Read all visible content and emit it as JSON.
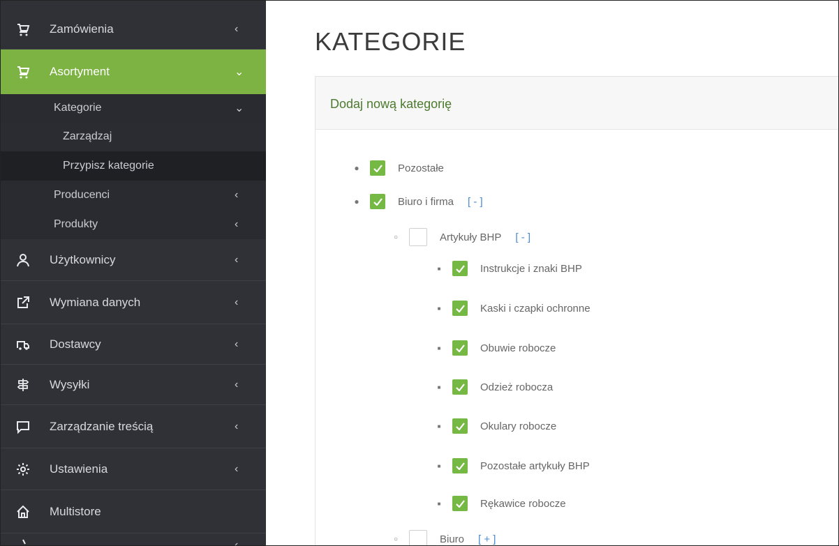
{
  "sidebar": {
    "items": [
      {
        "label": "Zamówienia",
        "icon": "cart-icon",
        "chevron": "‹"
      },
      {
        "label": "Asortyment",
        "icon": "cart-icon",
        "chevron": "⌄"
      },
      {
        "label": "Użytkownicy",
        "icon": "user-icon",
        "chevron": "‹"
      },
      {
        "label": "Wymiana danych",
        "icon": "external-link-icon",
        "chevron": "‹"
      },
      {
        "label": "Dostawcy",
        "icon": "truck-icon",
        "chevron": "‹"
      },
      {
        "label": "Wysyłki",
        "icon": "signpost-icon",
        "chevron": "‹"
      },
      {
        "label": "Zarządzanie treścią",
        "icon": "comment-icon",
        "chevron": "‹"
      },
      {
        "label": "Ustawienia",
        "icon": "gear-icon",
        "chevron": "‹"
      },
      {
        "label": "Multistore",
        "icon": "home-icon",
        "chevron": ""
      }
    ],
    "sub": {
      "kategorie": "Kategorie",
      "kategorie_chevron": "⌄",
      "zarzadzaj": "Zarządzaj",
      "przypisz": "Przypisz kategorie",
      "producenci": "Producenci",
      "produkty": "Produkty",
      "chevron": "‹"
    },
    "accent_color": "#7cb342"
  },
  "main": {
    "title": "KATEGORIE",
    "panel_heading": "Dodaj nową kategorię",
    "tree": [
      {
        "label": "Pozostałe",
        "checked": true,
        "level": 1
      },
      {
        "label": "Biuro i firma",
        "checked": true,
        "level": 1,
        "toggle": "[ - ]"
      },
      {
        "label": "Artykuły BHP",
        "checked": false,
        "level": 2,
        "toggle": "[ - ]"
      },
      {
        "label": "Instrukcje i znaki BHP",
        "checked": true,
        "level": 3
      },
      {
        "label": "Kaski i czapki ochronne",
        "checked": true,
        "level": 3
      },
      {
        "label": "Obuwie robocze",
        "checked": true,
        "level": 3
      },
      {
        "label": "Odzież robocza",
        "checked": true,
        "level": 3
      },
      {
        "label": "Okulary robocze",
        "checked": true,
        "level": 3
      },
      {
        "label": "Pozostałe artykuły BHP",
        "checked": true,
        "level": 3
      },
      {
        "label": "Rękawice robocze",
        "checked": true,
        "level": 3
      },
      {
        "label": "Biuro",
        "checked": false,
        "level": 2,
        "toggle": "[ + ]"
      }
    ]
  }
}
